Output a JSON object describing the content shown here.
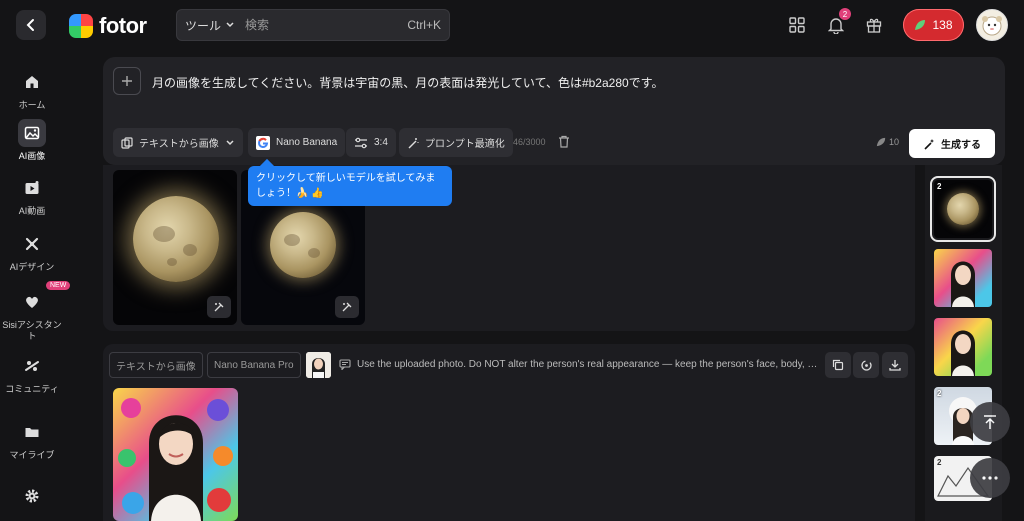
{
  "header": {
    "brand": "fotor",
    "tool_select": "ツール",
    "search_placeholder": "検索",
    "shortcut": "Ctrl+K",
    "notification_count": "2",
    "credits": "138"
  },
  "sidebar": {
    "items": [
      {
        "label": "ホーム",
        "icon": "home-icon"
      },
      {
        "label": "AI画像",
        "icon": "image-icon",
        "active": true
      },
      {
        "label": "AI動画",
        "icon": "video-icon"
      },
      {
        "label": "AIデザイン",
        "icon": "design-icon"
      },
      {
        "label": "Sisiアシスタント",
        "icon": "heart-icon",
        "badge": "NEW"
      },
      {
        "label": "コミュニティ",
        "icon": "community-icon"
      },
      {
        "label": "マイライブ",
        "icon": "folder-icon"
      }
    ]
  },
  "prompt": {
    "text": "月の画像を生成してください。背景は宇宙の黒、月の表面は発光していて、色は#b2a280です。",
    "mode": "テキストから画像",
    "model": "Nano Banana",
    "ratio": "3:4",
    "optimize": "プロンプト最適化",
    "char_count": "46/3000",
    "cost": "10",
    "generate": "生成する"
  },
  "tooltip": {
    "text": "クリックして新しいモデルを試してみましょう！🍌 👍"
  },
  "history": {
    "mode_tag": "テキストから画像",
    "model_tag": "Nano Banana Pro",
    "prompt": "Use the uploaded photo. Do NOT alter the person's real appearance — keep the person's face, body, …"
  },
  "right_thumbs": [
    {
      "count": "2",
      "type": "moon"
    },
    {
      "count": "",
      "type": "portrait"
    },
    {
      "count": "",
      "type": "portrait"
    },
    {
      "count": "2",
      "type": "winter"
    },
    {
      "count": "2",
      "type": "sketch"
    }
  ],
  "colors": {
    "accent_red": "#d42a2f",
    "tooltip_blue": "#1f7df2",
    "moon_color": "#b2a280"
  }
}
